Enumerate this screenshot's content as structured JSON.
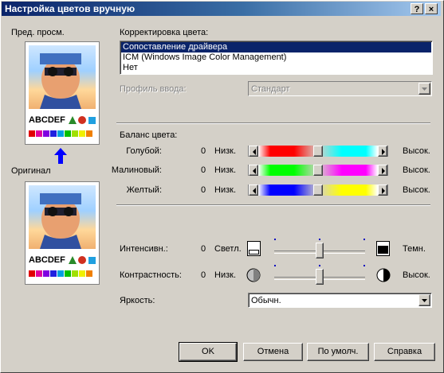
{
  "window": {
    "title": "Настройка цветов вручную",
    "help_label": "?",
    "close_label": "×"
  },
  "preview": {
    "top_label": "Пред. просм.",
    "bottom_label": "Оригинал",
    "sample_text": "ABCDEF"
  },
  "correction": {
    "label": "Корректировка цвета:",
    "options": [
      "Сопоставление драйвера",
      "ICM (Windows Image Color Management)",
      "Нет"
    ],
    "selected_index": 0
  },
  "input_profile": {
    "label": "Профиль ввода:",
    "value": "Стандарт",
    "disabled": true
  },
  "balance": {
    "label": "Баланс цвета:",
    "rows": [
      {
        "name": "Голубой:",
        "value": "0",
        "low": "Низк.",
        "high": "Высок.",
        "left_color": "#ff0000",
        "right_color": "#00ffff",
        "level": 0.5
      },
      {
        "name": "Малиновый:",
        "value": "0",
        "low": "Низк.",
        "high": "Высок.",
        "left_color": "#00ff00",
        "right_color": "#ff00ff",
        "level": 0.5
      },
      {
        "name": "Желтый:",
        "value": "0",
        "low": "Низк.",
        "high": "Высок.",
        "left_color": "#0000ff",
        "right_color": "#ffff00",
        "level": 0.5
      }
    ]
  },
  "intensity": {
    "label": "Интенсивн.:",
    "value": "0",
    "low": "Светл.",
    "high": "Темн.",
    "level": 0.5
  },
  "contrast": {
    "label": "Контрастность:",
    "value": "0",
    "low": "Низк.",
    "high": "Высок.",
    "level": 0.5
  },
  "brightness": {
    "label": "Яркость:",
    "value": "Обычн."
  },
  "buttons": {
    "ok": "OK",
    "cancel": "Отмена",
    "default": "По умолч.",
    "help": "Справка"
  }
}
